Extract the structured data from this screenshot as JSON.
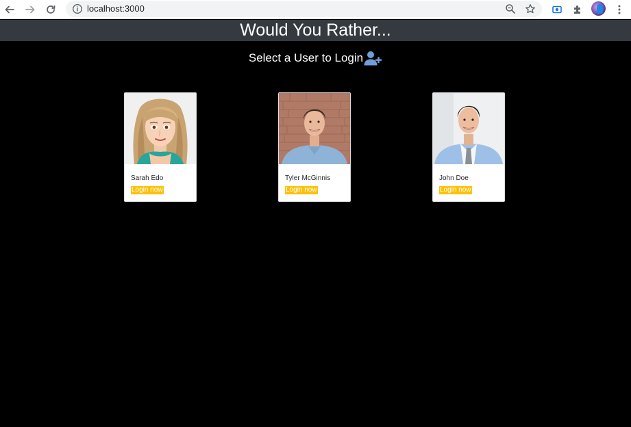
{
  "browser": {
    "url": "localhost:3000",
    "icons": [
      "back-arrow-icon",
      "forward-arrow-icon",
      "reload-icon",
      "info-icon",
      "zoom-icon",
      "star-icon",
      "screencast-icon",
      "puzzle-icon",
      "profile-avatar",
      "kebab-menu-icon"
    ]
  },
  "header": {
    "title": "Would You Rather..."
  },
  "login": {
    "prompt": "Select a User to Login",
    "icon": "user-plus-icon",
    "icon_color": "#6f9fd8"
  },
  "users": [
    {
      "name": "Sarah Edo",
      "action": "Login now"
    },
    {
      "name": "Tyler McGinnis",
      "action": "Login now"
    },
    {
      "name": "John Doe",
      "action": "Login now"
    }
  ],
  "colors": {
    "header_bg": "#343a40",
    "page_bg": "#000000",
    "login_badge": "#ffc107"
  }
}
